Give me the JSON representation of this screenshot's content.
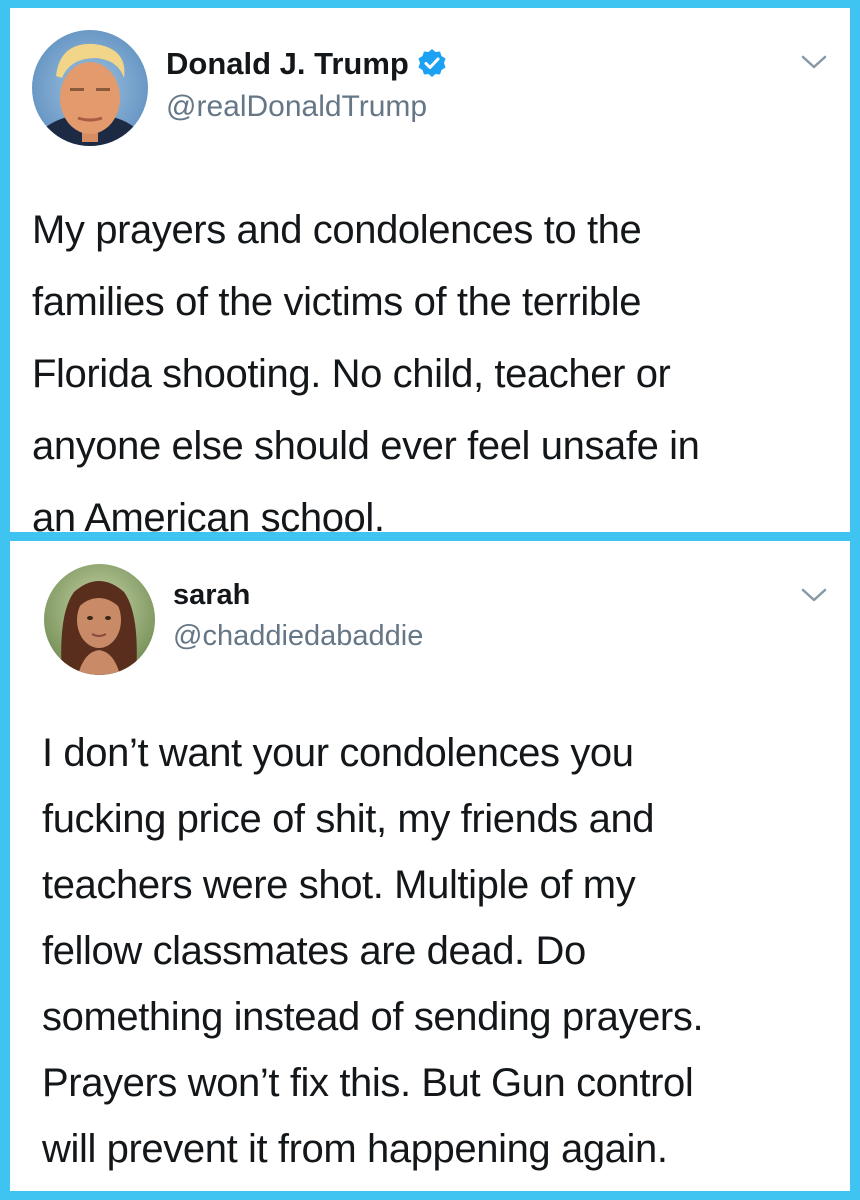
{
  "tweets": [
    {
      "display_name": "Donald J. Trump",
      "verified": true,
      "handle": "@realDonaldTrump",
      "avatar_icon": "profile-photo",
      "menu_icon": "chevron-down-icon",
      "text_lines": [
        "My prayers and condolences to the",
        "families of the victims of the terrible",
        "Florida shooting. No child, teacher or",
        "anyone else should ever feel unsafe in",
        "an American school."
      ]
    },
    {
      "display_name": "sarah",
      "verified": false,
      "handle": "@chaddiedabaddie",
      "avatar_icon": "profile-photo",
      "menu_icon": "chevron-down-icon",
      "text_lines": [
        "I don’t want your condolences you",
        "fucking price of shit, my friends and",
        "teachers were shot. Multiple of my",
        "fellow classmates are dead. Do",
        "something instead of sending prayers.",
        "Prayers won’t fix this. But Gun control",
        "will prevent it from happening again."
      ]
    }
  ],
  "colors": {
    "frame": "#3fc3f0",
    "card": "#ffffff",
    "text": "#14171a",
    "handle": "#657786",
    "verified_badge": "#1da1f2"
  }
}
